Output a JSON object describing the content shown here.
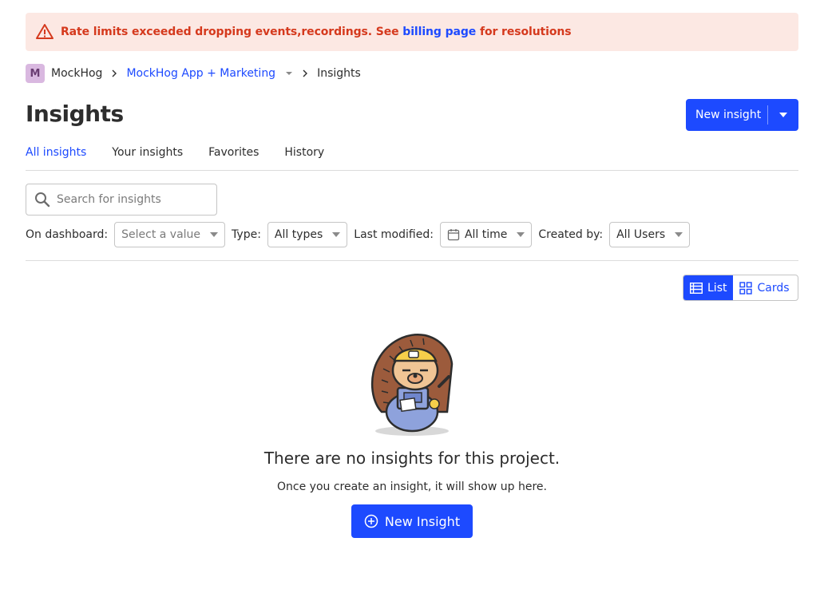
{
  "banner": {
    "text_before": "Rate limits exceeded dropping events,recordings. See",
    "link": "billing page",
    "text_after": "for resolutions",
    "icon": "warning-triangle-icon",
    "color": "#d5391d"
  },
  "breadcrumb": {
    "org_initial": "M",
    "org_name": "MockHog",
    "project": "MockHog App + Marketing",
    "current": "Insights"
  },
  "page": {
    "title": "Insights",
    "new_insight_label": "New insight"
  },
  "tabs": [
    {
      "label": "All insights",
      "active": true
    },
    {
      "label": "Your insights",
      "active": false
    },
    {
      "label": "Favorites",
      "active": false
    },
    {
      "label": "History",
      "active": false
    }
  ],
  "search": {
    "placeholder": "Search for insights"
  },
  "filters": {
    "dashboard_label": "On dashboard:",
    "dashboard_value": "Select a value",
    "type_label": "Type:",
    "type_value": "All types",
    "modified_label": "Last modified:",
    "modified_value": "All time",
    "created_label": "Created by:",
    "created_value": "All Users"
  },
  "view_toggle": {
    "list": "List",
    "cards": "Cards",
    "active": "list"
  },
  "empty_state": {
    "title": "There are no insights for this project.",
    "subtitle": "Once you create an insight, it will show up here.",
    "button": "New Insight"
  },
  "colors": {
    "primary": "#1d4aff",
    "banner_bg": "#fce8e3",
    "danger": "#d5391d"
  }
}
